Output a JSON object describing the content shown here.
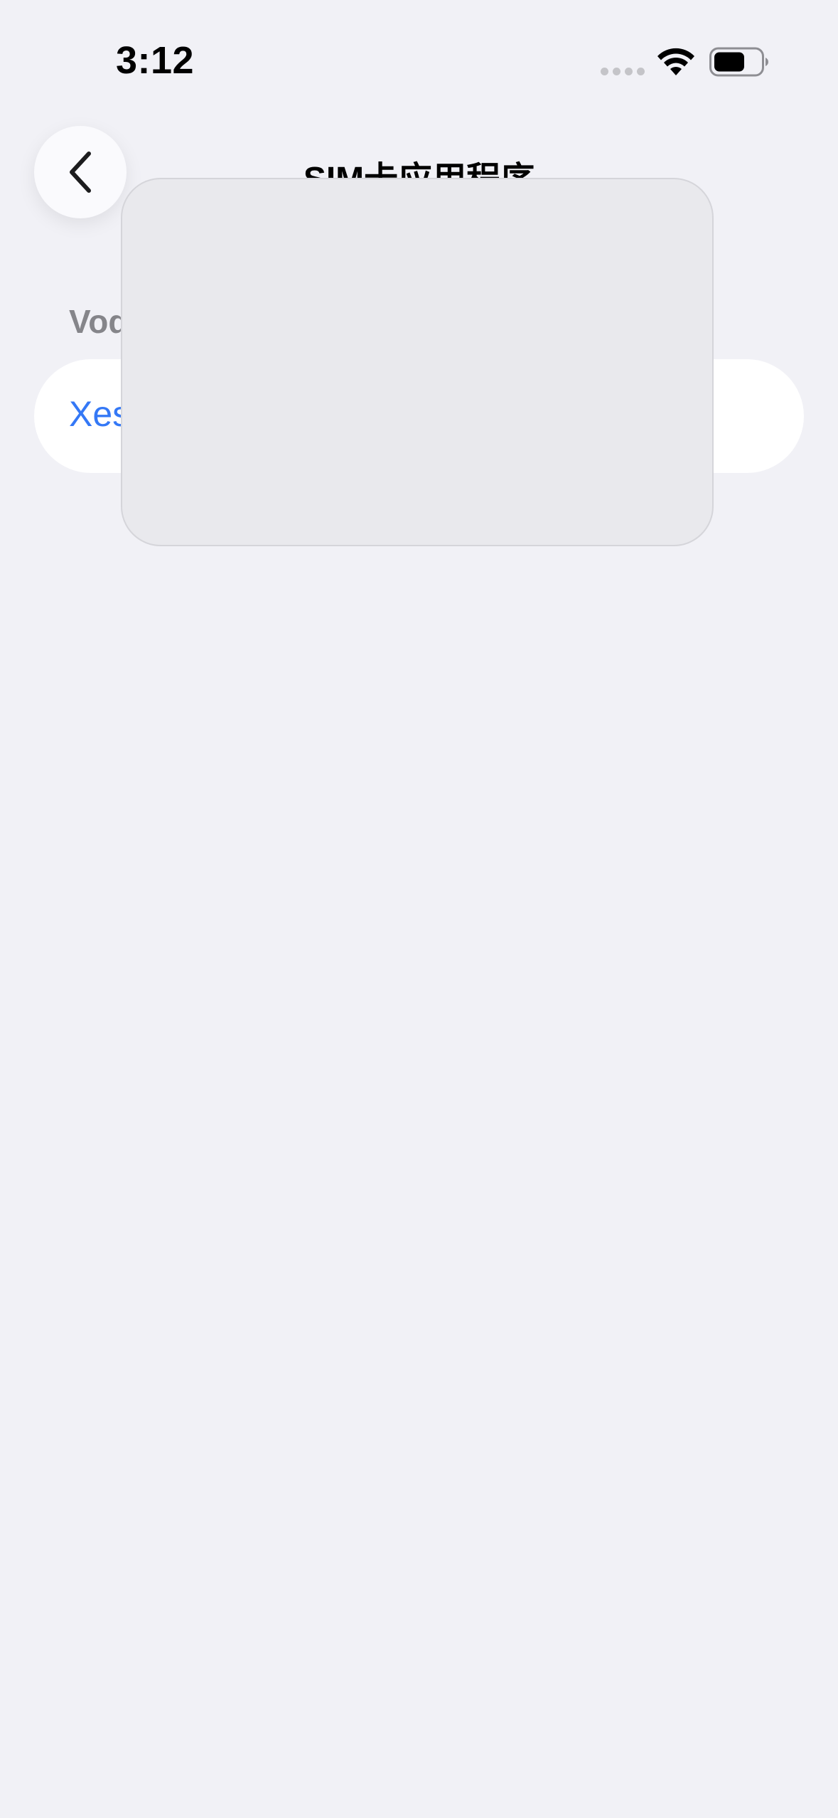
{
  "status_bar": {
    "time": "3:12",
    "icons": [
      "signal-dots-icon",
      "wifi-icon",
      "battery-icon"
    ]
  },
  "nav": {
    "back_icon": "chevron-left-icon",
    "title": "SIM卡应用程序"
  },
  "section": {
    "header": "Voda",
    "items": [
      {
        "label": "Xes"
      }
    ]
  },
  "colors": {
    "background": "#f1f1f6",
    "card": "#ffffff",
    "accent": "#3478f6",
    "secondary_text": "#85858a",
    "overlay": "#e9e9ed"
  }
}
